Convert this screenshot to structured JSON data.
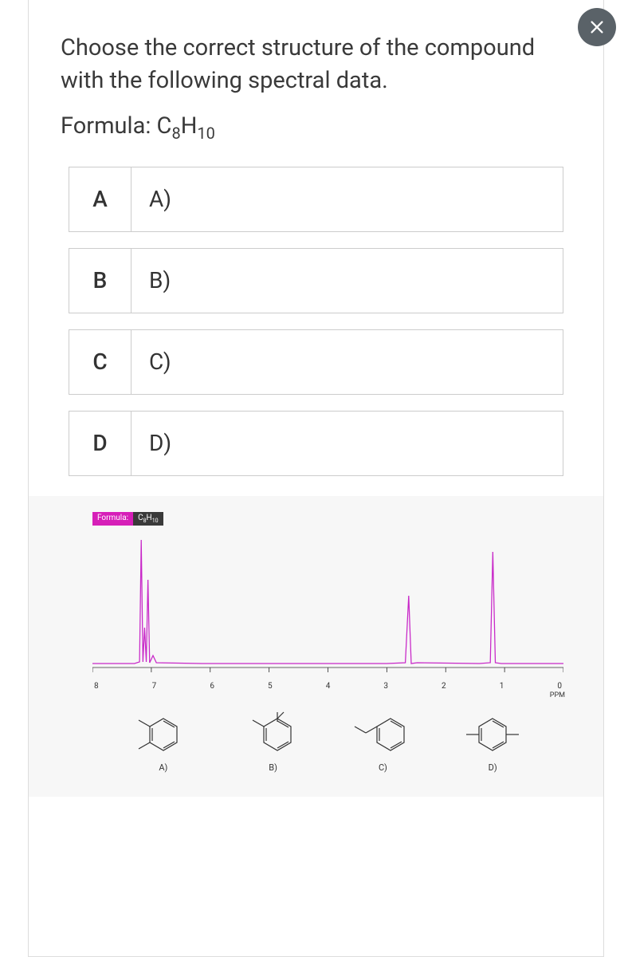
{
  "question": "Choose the correct structure of the compound with the following spectral data.",
  "formula_label": "Formula: C",
  "formula_sub1": "8",
  "formula_mid": "H",
  "formula_sub2": "10",
  "options": [
    {
      "letter": "A",
      "text": "A)"
    },
    {
      "letter": "B",
      "text": "B)"
    },
    {
      "letter": "C",
      "text": "C)"
    },
    {
      "letter": "D",
      "text": "D)"
    }
  ],
  "spectrum": {
    "badge_label": "Formula:",
    "badge_formula_c": "C",
    "badge_formula_s1": "8",
    "badge_formula_h": "H",
    "badge_formula_s2": "10",
    "ppm_label": "PPM",
    "ticks": [
      "8",
      "7",
      "6",
      "5",
      "4",
      "3",
      "2",
      "1",
      "0"
    ],
    "structures": [
      {
        "label": "A)"
      },
      {
        "label": "B)"
      },
      {
        "label": "C)"
      },
      {
        "label": "D)"
      }
    ]
  },
  "chart_data": {
    "type": "line",
    "title": "NMR Spectrum",
    "xlabel": "PPM",
    "ylabel": "",
    "xlim": [
      0,
      8
    ],
    "peaks": [
      {
        "ppm": 7.15,
        "intensity_rel": 1.0,
        "multiplet": true
      },
      {
        "ppm": 2.6,
        "intensity_rel": 0.55
      },
      {
        "ppm": 1.2,
        "intensity_rel": 0.9
      }
    ]
  }
}
